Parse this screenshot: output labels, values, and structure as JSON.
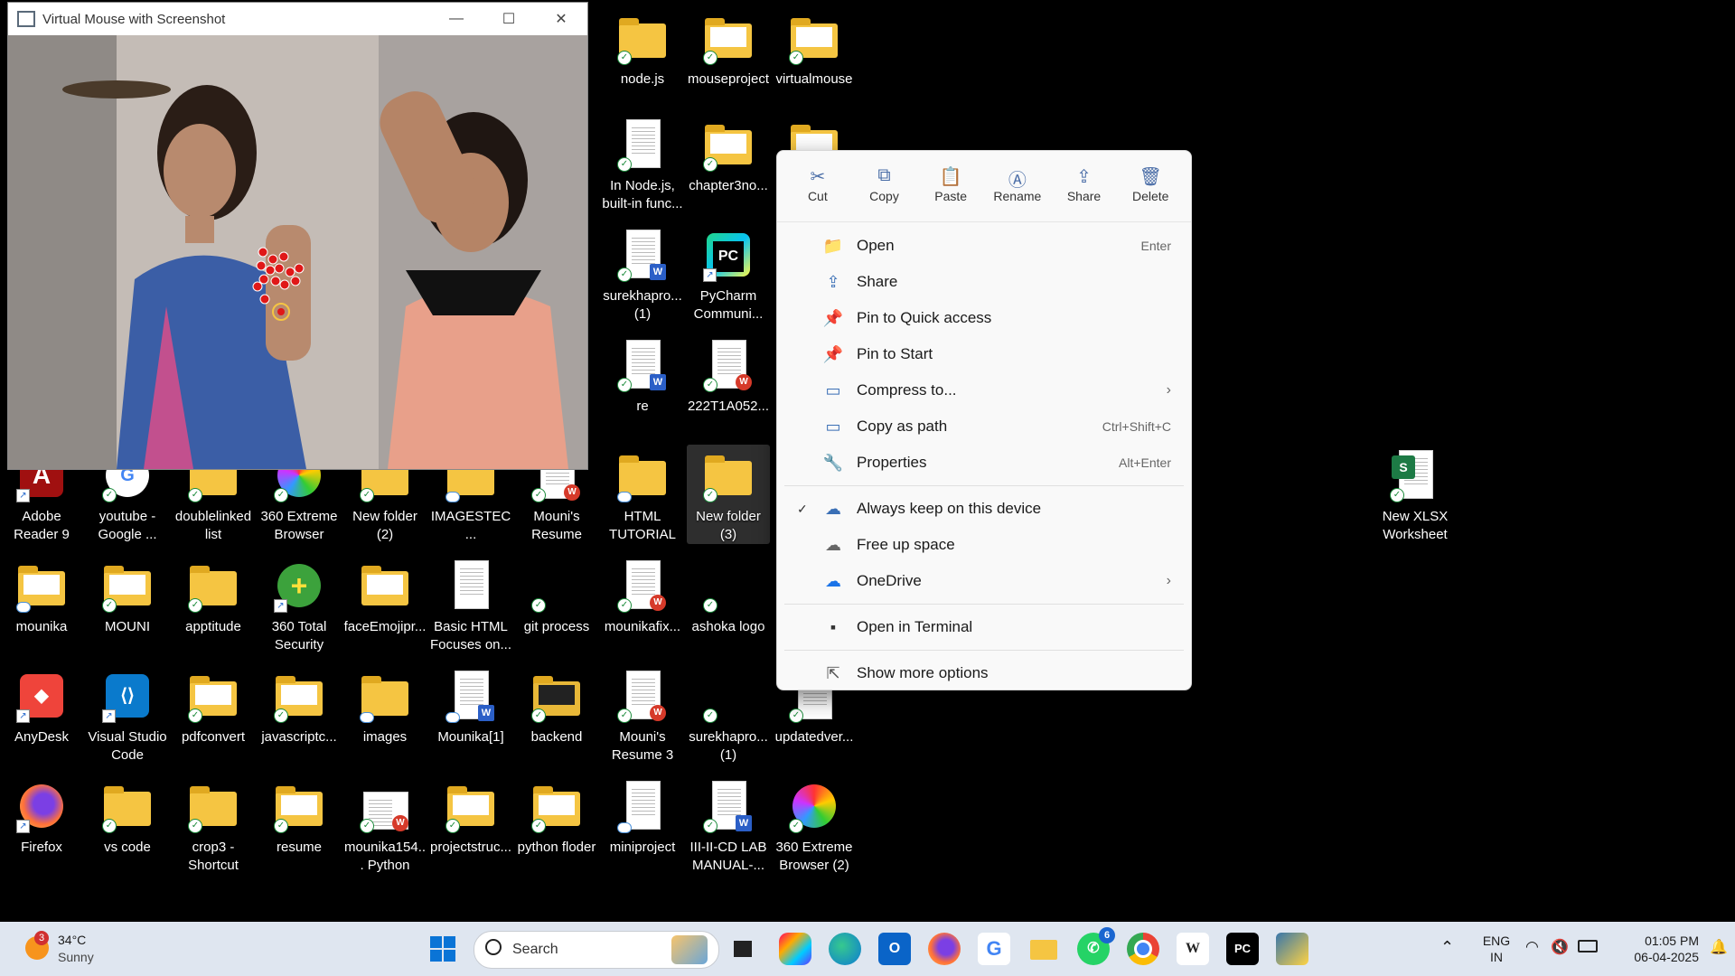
{
  "camera_window": {
    "title": "Virtual Mouse with Screenshot",
    "minimize": "—",
    "maximize": "☐",
    "close": "✕"
  },
  "desktop_icons": [
    {
      "label": "node.js"
    },
    {
      "label": "mouseproject"
    },
    {
      "label": "virtualmouse"
    },
    {
      "label": "In Node.js, built-in func..."
    },
    {
      "label": "chapter3no..."
    },
    {
      "label": "surekhapro... (1)"
    },
    {
      "label": "PyCharm Communi..."
    },
    {
      "label": "re"
    },
    {
      "label": "222T1A052..."
    },
    {
      "label": "Adobe Reader 9"
    },
    {
      "label": "youtube - Google ..."
    },
    {
      "label": "doublelinked list"
    },
    {
      "label": "360 Extreme Browser"
    },
    {
      "label": "New folder (2)"
    },
    {
      "label": "IMAGESTEC..."
    },
    {
      "label": "Mouni's Resume"
    },
    {
      "label": "HTML TUTORIAL"
    },
    {
      "label": "New folder (3)"
    },
    {
      "label": "New XLSX Worksheet"
    },
    {
      "label": "mounika"
    },
    {
      "label": "MOUNI"
    },
    {
      "label": "apptitude"
    },
    {
      "label": "360 Total Security"
    },
    {
      "label": "faceEmojipr..."
    },
    {
      "label": "Basic HTML Focuses on..."
    },
    {
      "label": "git process"
    },
    {
      "label": "mounikafix..."
    },
    {
      "label": "ashoka logo"
    },
    {
      "label": "AnyDesk"
    },
    {
      "label": "Visual Studio Code"
    },
    {
      "label": "pdfconvert"
    },
    {
      "label": "javascriptc..."
    },
    {
      "label": "images"
    },
    {
      "label": "Mounika[1]"
    },
    {
      "label": "backend"
    },
    {
      "label": "Mouni's Resume 3"
    },
    {
      "label": "surekhapro... (1)"
    },
    {
      "label": "updatedver..."
    },
    {
      "label": "Firefox"
    },
    {
      "label": "vs code"
    },
    {
      "label": "crop3 - Shortcut"
    },
    {
      "label": "resume"
    },
    {
      "label": "mounika154... Python"
    },
    {
      "label": "projectstruc..."
    },
    {
      "label": "python floder"
    },
    {
      "label": "miniproject"
    },
    {
      "label": "III-II-CD LAB MANUAL-..."
    },
    {
      "label": "360 Extreme Browser (2)"
    }
  ],
  "context_menu": {
    "toolbar": [
      {
        "label": "Cut",
        "icon": "✂"
      },
      {
        "label": "Copy",
        "icon": "⧉"
      },
      {
        "label": "Paste",
        "icon": "📋"
      },
      {
        "label": "Rename",
        "icon": "Ⓐ"
      },
      {
        "label": "Share",
        "icon": "⇪"
      },
      {
        "label": "Delete",
        "icon": "🗑"
      }
    ],
    "items": [
      {
        "label": "Open",
        "shortcut": "Enter",
        "icon": "📁"
      },
      {
        "label": "Share",
        "shortcut": "",
        "icon": "⇪"
      },
      {
        "label": "Pin to Quick access",
        "shortcut": "",
        "icon": "📌"
      },
      {
        "label": "Pin to Start",
        "shortcut": "",
        "icon": "📌"
      },
      {
        "label": "Compress to...",
        "shortcut": "",
        "icon": "▭",
        "arrow": "›"
      },
      {
        "label": "Copy as path",
        "shortcut": "Ctrl+Shift+C",
        "icon": "▭"
      },
      {
        "label": "Properties",
        "shortcut": "Alt+Enter",
        "icon": "🔧"
      },
      {
        "label": "Always keep on this device",
        "shortcut": "",
        "icon": "☁",
        "check": "✓"
      },
      {
        "label": "Free up space",
        "shortcut": "",
        "icon": "☁"
      },
      {
        "label": "OneDrive",
        "shortcut": "",
        "icon": "☁",
        "arrow": "›"
      },
      {
        "label": "Open in Terminal",
        "shortcut": "",
        "icon": "▪"
      },
      {
        "label": "Show more options",
        "shortcut": "",
        "icon": "⇱"
      }
    ]
  },
  "taskbar": {
    "weather_temp": "34°C",
    "weather_desc": "Sunny",
    "weather_badge": "3",
    "search_placeholder": "Search",
    "whatsapp_badge": "6",
    "lang_top": "ENG",
    "lang_bottom": "IN",
    "time": "01:05 PM",
    "date": "06-04-2025"
  }
}
